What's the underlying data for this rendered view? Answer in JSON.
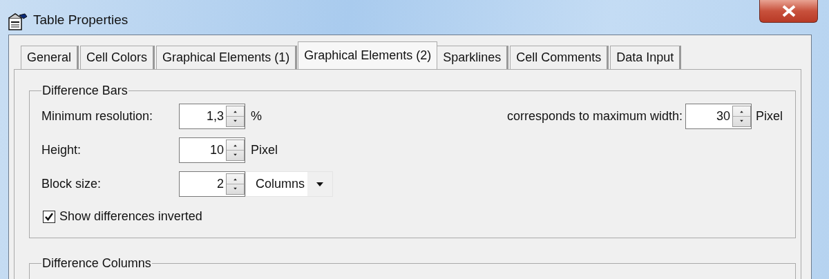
{
  "window": {
    "title": "Table Properties"
  },
  "tabs": [
    {
      "label": "General",
      "selected": false
    },
    {
      "label": "Cell Colors",
      "selected": false
    },
    {
      "label": "Graphical Elements (1)",
      "selected": false
    },
    {
      "label": "Graphical Elements (2)",
      "selected": true
    },
    {
      "label": "Sparklines",
      "selected": false
    },
    {
      "label": "Cell Comments",
      "selected": false
    },
    {
      "label": "Data Input",
      "selected": false
    }
  ],
  "difference_bars": {
    "title": "Difference Bars",
    "minimum_resolution": {
      "label": "Minimum resolution:",
      "value": "1,3",
      "unit": "%"
    },
    "height": {
      "label": "Height:",
      "value": "10",
      "unit": "Pixel"
    },
    "block_size": {
      "label": "Block size:",
      "value": "2",
      "unit_dropdown": "Columns"
    },
    "show_inverted": {
      "label": "Show differences inverted",
      "checked": true
    },
    "maximum_width": {
      "label": "corresponds to maximum width:",
      "value": "30",
      "unit": "Pixel"
    }
  },
  "difference_columns": {
    "title": "Difference Columns"
  }
}
